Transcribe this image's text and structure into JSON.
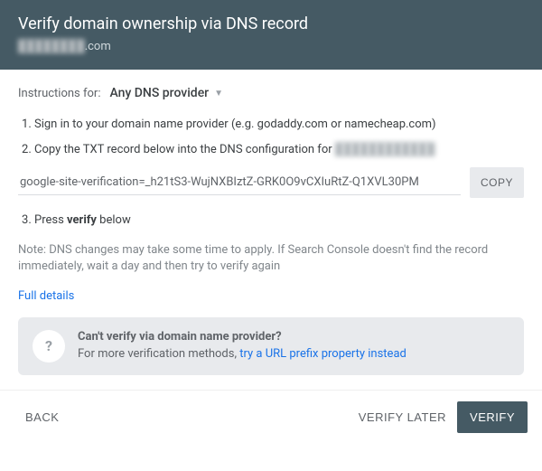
{
  "header": {
    "title": "Verify domain ownership via DNS record",
    "domain_blur_prefix": "████████",
    "domain_suffix": ".com"
  },
  "provider": {
    "label": "Instructions for:",
    "selected": "Any DNS provider"
  },
  "steps": {
    "s1": "Sign in to your domain name provider (e.g. godaddy.com or namecheap.com)",
    "s2_prefix": "Copy the TXT record below into the DNS configuration for ",
    "s2_blur": "████████████",
    "s3_prefix": "Press ",
    "s3_bold": "verify",
    "s3_suffix": " below"
  },
  "txt": {
    "value": "google-site-verification=_h21tS3-WujNXBIztZ-GRK0O9vCXIuRtZ-Q1XVL30PM",
    "copy_label": "COPY"
  },
  "note": "Note: DNS changes may take some time to apply. If Search Console doesn't find the record immediately, wait a day and then try to verify again",
  "full_details": "Full details",
  "tip": {
    "icon": "?",
    "title": "Can't verify via domain name provider?",
    "text_prefix": "For more verification methods, ",
    "link": "try a URL prefix property instead"
  },
  "footer": {
    "back": "BACK",
    "later": "VERIFY LATER",
    "verify": "VERIFY"
  }
}
